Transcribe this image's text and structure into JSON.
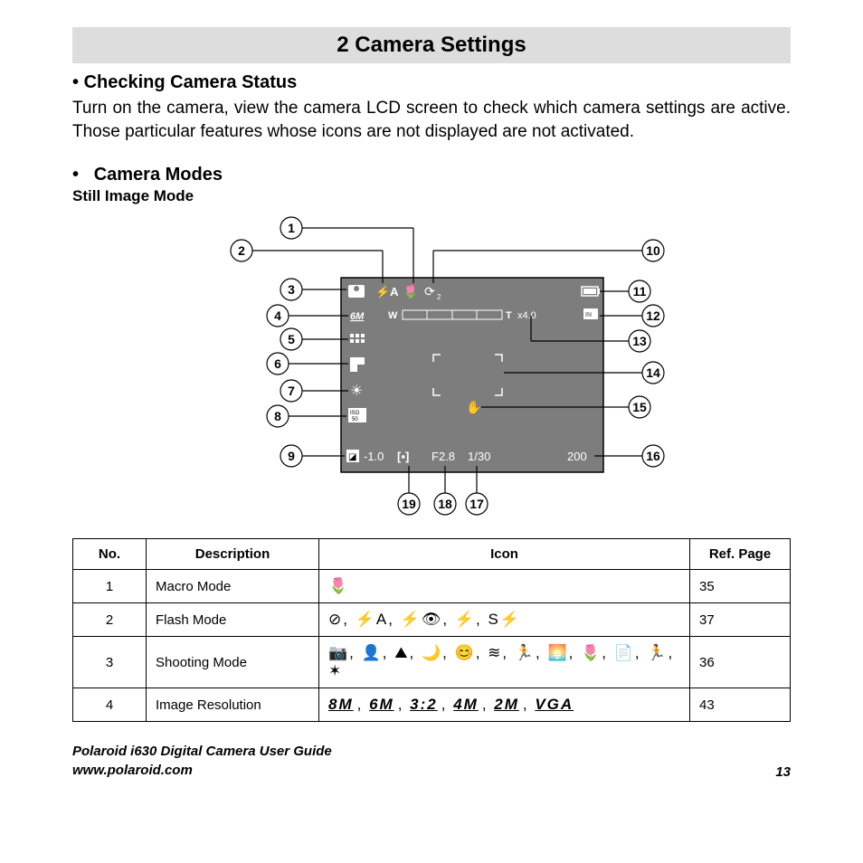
{
  "title": "2 Camera Settings",
  "section1": {
    "bullet": "•",
    "heading": "Checking Camera Status",
    "body": "Turn on the camera, view the camera LCD screen to check which camera settings are active. Those particular features whose icons are not displayed are not activated."
  },
  "section2": {
    "bullet": "•",
    "heading": "Camera Modes",
    "subheading": "Still Image Mode"
  },
  "diagram": {
    "labels": [
      "1",
      "2",
      "3",
      "4",
      "5",
      "6",
      "7",
      "8",
      "9",
      "10",
      "11",
      "12",
      "13",
      "14",
      "15",
      "16",
      "17",
      "18",
      "19"
    ],
    "lcd": {
      "flash_auto": "⚡A",
      "macro": "🌷",
      "timer": "⟳",
      "timer_sub": "2",
      "resolution": "6M",
      "zoom_w": "W",
      "zoom_t": "T",
      "zoom_value": "x4.0",
      "storage": "IN",
      "iso": "ISO 50",
      "exposure": "-1.0",
      "aperture": "F2.8",
      "shutter": "1/30",
      "shots": "200"
    }
  },
  "table": {
    "headers": [
      "No.",
      "Description",
      "Icon",
      "Ref. Page"
    ],
    "rows": [
      {
        "no": "1",
        "desc": "Macro Mode",
        "icon_text": "🌷",
        "page": "35"
      },
      {
        "no": "2",
        "desc": "Flash Mode",
        "icon_text": "⊘, ⚡A, ⚡👁, ⚡, S⚡",
        "page": "37"
      },
      {
        "no": "3",
        "desc": "Shooting Mode",
        "icon_text": "📷, 👤, ⛰, 🌙, 😊, ≋, 🏃, 🌅, 🌷, 📄, 🏃, ✶",
        "page": "36"
      },
      {
        "no": "4",
        "desc": "Image Resolution",
        "icon_text": "",
        "resolutions": [
          "8M",
          "6M",
          "3:2",
          "4M",
          "2M",
          "VGA"
        ],
        "page": "43"
      }
    ]
  },
  "footer": {
    "guide": "Polaroid i630 Digital Camera User Guide",
    "url": "www.polaroid.com",
    "page": "13"
  }
}
